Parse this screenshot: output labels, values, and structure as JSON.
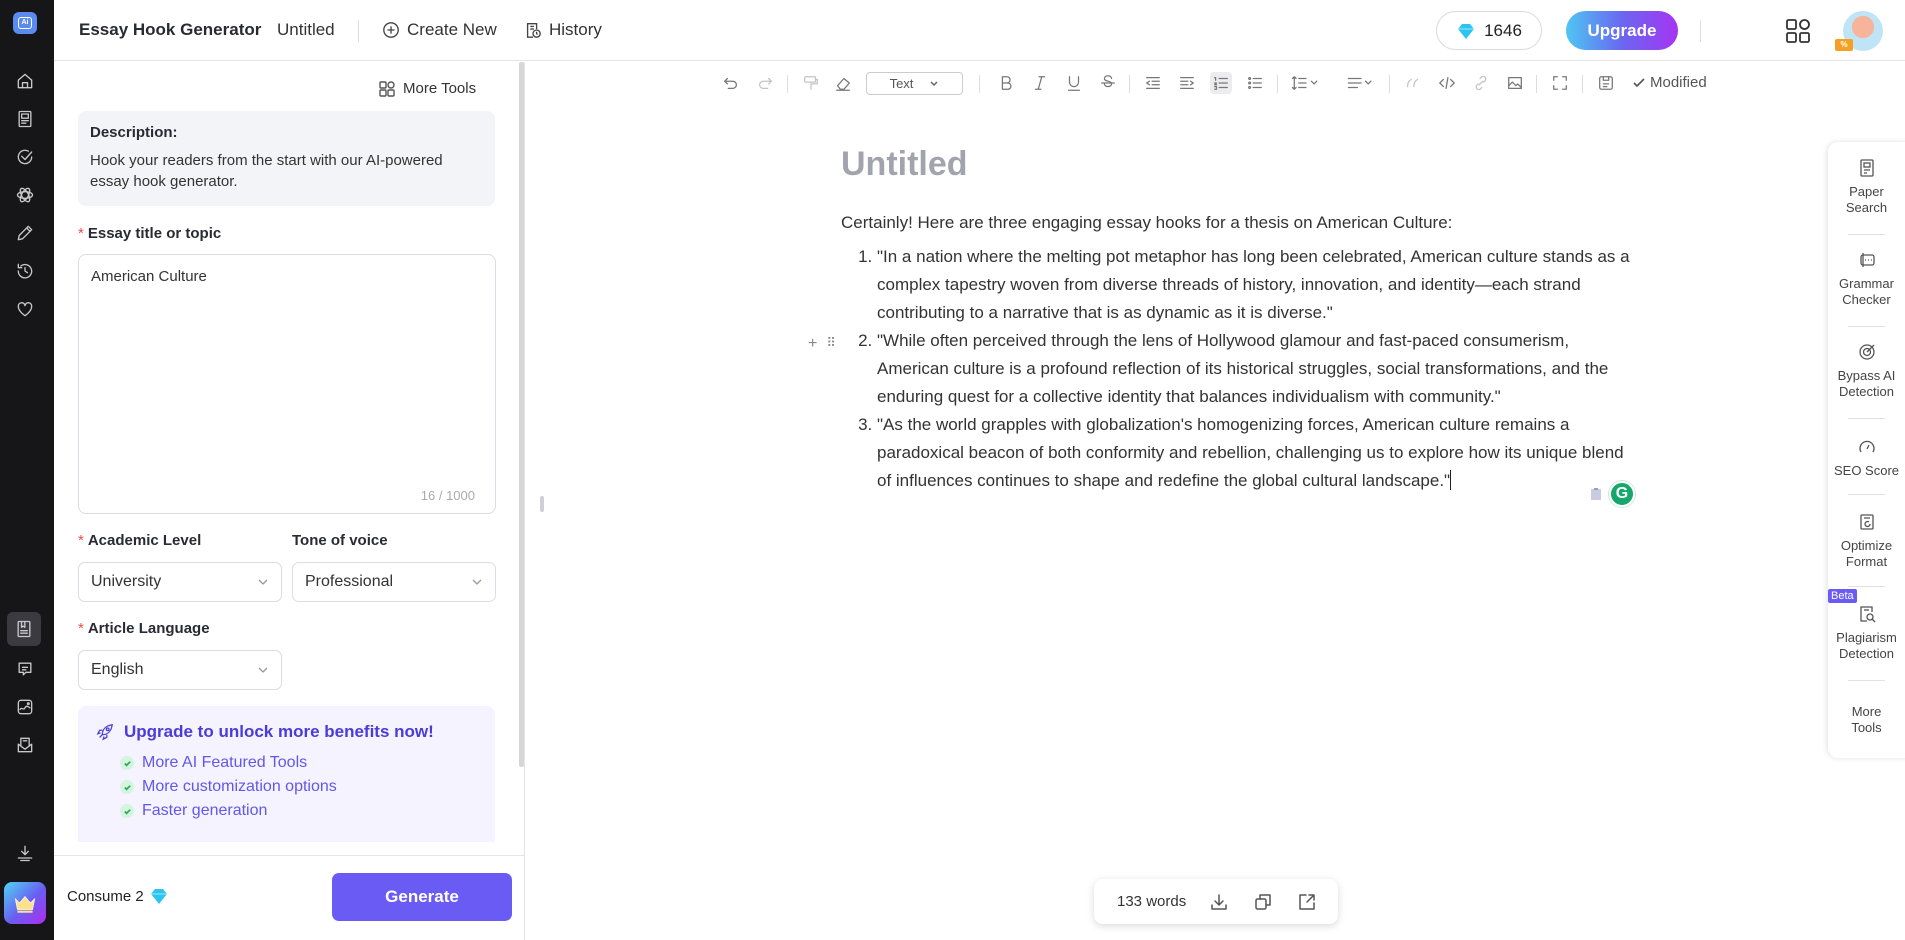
{
  "rail": {
    "top_icons": [
      "home-icon",
      "document-icon",
      "check-circle-icon",
      "atom-icon",
      "pencil-icon",
      "history-icon",
      "heart-icon"
    ],
    "bottom_icons": [
      "book-icon",
      "chat-icon",
      "image-icon",
      "mail-icon"
    ],
    "download_icon": "download-icon",
    "premium_icon": "crown-icon"
  },
  "header": {
    "app_title": "Essay Hook Generator",
    "doc_name": "Untitled",
    "create_new": "Create New",
    "history": "History",
    "credits": "1646",
    "upgrade": "Upgrade",
    "avatar_badge": "%"
  },
  "panel": {
    "more_tools": "More Tools",
    "description_title": "Description:",
    "description_text": "Hook your readers from the start with our AI-powered essay hook generator.",
    "topic_label": "Essay title or topic",
    "topic_value": "American Culture",
    "topic_counter": "16 / 1000",
    "academic_label": "Academic Level",
    "academic_value": "University",
    "tone_label": "Tone of voice",
    "tone_value": "Professional",
    "language_label": "Article Language",
    "language_value": "English",
    "required_mark": "*",
    "promo_title": "Upgrade to unlock more benefits now!",
    "promo_items": [
      "More AI Featured Tools",
      "More customization options",
      "Faster generation"
    ],
    "consume_label": "Consume 2",
    "generate": "Generate"
  },
  "toolbar": {
    "text_style": "Text",
    "status": "Modified"
  },
  "document": {
    "title": "Untitled",
    "intro": "Certainly! Here are three engaging essay hooks for a thesis on American Culture:",
    "hooks": [
      "\"In a nation where the melting pot metaphor has long been celebrated, American culture stands as a complex tapestry woven from diverse threads of history, innovation, and identity—each strand contributing to a narrative that is as dynamic as it is diverse.\"",
      "\"While often perceived through the lens of Hollywood glamour and fast-paced consumerism, American culture is a profound reflection of its historical struggles, social transformations, and the enduring quest for a collective identity that balances individualism with community.\"",
      "\"As the world grapples with globalization's homogenizing forces, American culture remains a paradoxical beacon of both conformity and rebellion, challenging us to explore how its unique blend of influences continues to shape and redefine the global cultural landscape.\""
    ],
    "grammarly_letter": "G"
  },
  "right_tools": [
    {
      "label": "Paper Search",
      "icon": "paper-search-icon"
    },
    {
      "label": "Grammar Checker",
      "icon": "grammar-icon"
    },
    {
      "label": "Bypass AI Detection",
      "icon": "bypass-icon"
    },
    {
      "label": "SEO Score",
      "icon": "gauge-icon"
    },
    {
      "label": "Optimize Format",
      "icon": "optimize-icon"
    },
    {
      "label": "Plagiarism Detection",
      "icon": "plagiarism-icon"
    },
    {
      "label": "More Tools",
      "icon": ""
    }
  ],
  "beta_badge": "Beta",
  "word_count": "133 words",
  "colors": {
    "accent": "#6b5bf5",
    "promo_text": "#4a3cd6",
    "grammarly": "#15a76c"
  }
}
